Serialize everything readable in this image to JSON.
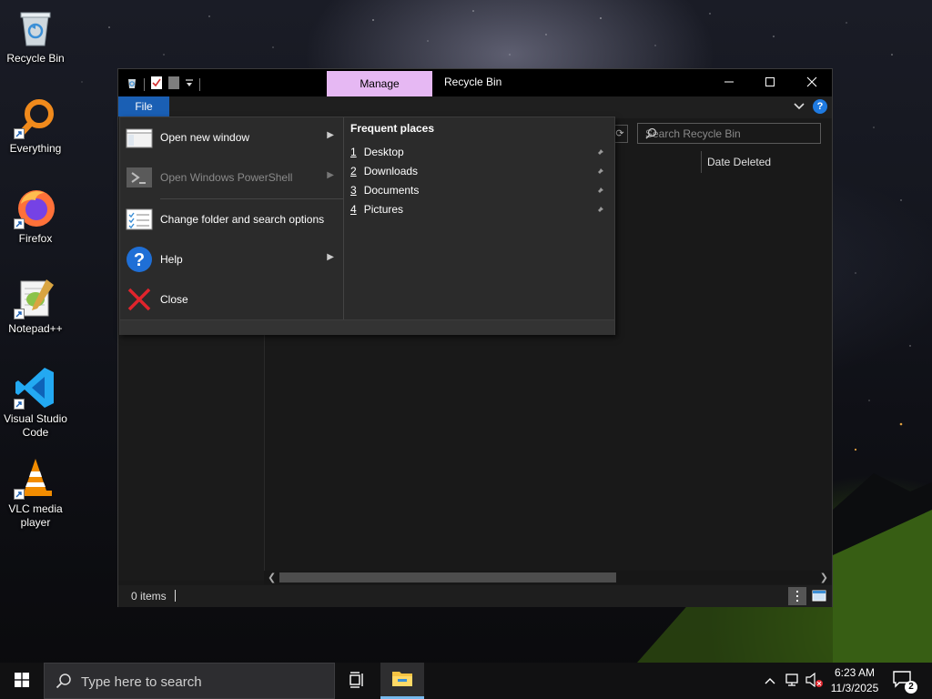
{
  "desktop": {
    "icons": [
      {
        "label": "Recycle Bin"
      },
      {
        "label": "Everything"
      },
      {
        "label": "Firefox"
      },
      {
        "label": "Notepad++"
      },
      {
        "label": "Visual Studio Code"
      },
      {
        "label": "VLC media player"
      }
    ]
  },
  "window": {
    "title": "Recycle Bin",
    "manage_tab": "Manage",
    "file_tab": "File",
    "search_placeholder": "Search Recycle Bin",
    "column_header": "Date Deleted",
    "status_text": "0 items",
    "accent_color": "#1a5fb4",
    "manage_color": "#e6b8f3"
  },
  "file_menu": {
    "items": [
      {
        "label": "Open new window",
        "has_submenu": true,
        "enabled": true,
        "icon": "new-window-icon"
      },
      {
        "label": "Open Windows PowerShell",
        "has_submenu": true,
        "enabled": false,
        "icon": "powershell-icon"
      },
      {
        "label": "Change folder and search options",
        "has_submenu": false,
        "enabled": true,
        "icon": "folder-options-icon"
      },
      {
        "label": "Help",
        "has_submenu": true,
        "enabled": true,
        "icon": "help-icon"
      },
      {
        "label": "Close",
        "has_submenu": false,
        "enabled": true,
        "icon": "close-x-icon"
      }
    ],
    "frequent_places": {
      "title": "Frequent places",
      "items": [
        {
          "num": "1",
          "label": "Desktop"
        },
        {
          "num": "2",
          "label": "Downloads"
        },
        {
          "num": "3",
          "label": "Documents"
        },
        {
          "num": "4",
          "label": "Pictures"
        }
      ]
    }
  },
  "taskbar": {
    "search_placeholder": "Type here to search",
    "time": "6:23 AM",
    "date": "11/3/2025",
    "notification_count": "2"
  }
}
